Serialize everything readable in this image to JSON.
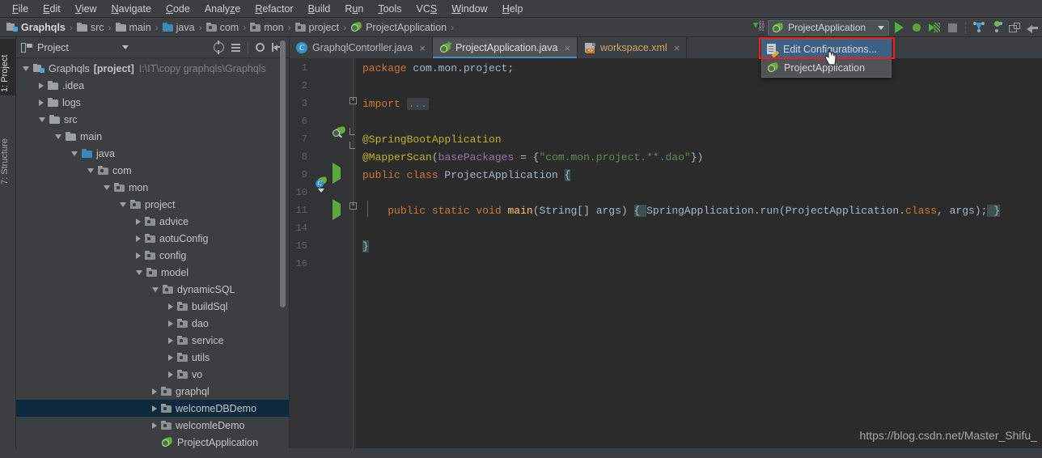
{
  "menubar": {
    "items": [
      {
        "label": "File",
        "mnemonic": "F"
      },
      {
        "label": "Edit",
        "mnemonic": "E"
      },
      {
        "label": "View",
        "mnemonic": "V"
      },
      {
        "label": "Navigate",
        "mnemonic": "N"
      },
      {
        "label": "Code",
        "mnemonic": "C"
      },
      {
        "label": "Analyze",
        "mnemonic": "z"
      },
      {
        "label": "Refactor",
        "mnemonic": "R"
      },
      {
        "label": "Build",
        "mnemonic": "B"
      },
      {
        "label": "Run",
        "mnemonic": "u"
      },
      {
        "label": "Tools",
        "mnemonic": "T"
      },
      {
        "label": "VCS",
        "mnemonic": "S"
      },
      {
        "label": "Window",
        "mnemonic": "W"
      },
      {
        "label": "Help",
        "mnemonic": "H"
      }
    ]
  },
  "breadcrumb": {
    "items": [
      {
        "label": "Graphqls",
        "icon": "module-icon"
      },
      {
        "label": "src",
        "icon": "folder-icon"
      },
      {
        "label": "main",
        "icon": "folder-icon"
      },
      {
        "label": "java",
        "icon": "source-folder-icon"
      },
      {
        "label": "com",
        "icon": "package-icon"
      },
      {
        "label": "mon",
        "icon": "package-icon"
      },
      {
        "label": "project",
        "icon": "package-icon"
      },
      {
        "label": "ProjectApplication",
        "icon": "spring-class-icon"
      }
    ],
    "separator": "›"
  },
  "toolbar": {
    "run_config_name": "ProjectApplication",
    "icons": [
      {
        "name": "step-over-icon",
        "title": "101"
      },
      {
        "name": "run-icon",
        "title": "Run"
      },
      {
        "name": "debug-icon",
        "title": "Debug"
      },
      {
        "name": "run-with-coverage-icon",
        "title": "Run with Coverage"
      },
      {
        "name": "stop-icon",
        "title": "Stop"
      },
      {
        "name": "update-project-icon",
        "title": "Update Project"
      },
      {
        "name": "commit-icon",
        "title": "Commit"
      },
      {
        "name": "settings-window-icon",
        "title": "Settings"
      },
      {
        "name": "back-arrow-icon",
        "title": "Back"
      }
    ]
  },
  "run_config_popup": {
    "items": [
      {
        "label": "Edit Configurations...",
        "icon": "edit-configurations-icon",
        "selected": true
      },
      {
        "label": "ProjectApplication",
        "icon": "spring-class-icon",
        "selected": false
      }
    ],
    "highlight_color": "#ee1c1c",
    "selection_color": "#3d6185"
  },
  "tool_windows": {
    "left": [
      {
        "label": "1: Project",
        "active": true
      },
      {
        "label": "7: Structure",
        "active": false
      }
    ]
  },
  "project_panel": {
    "title": "Project",
    "header_icons": [
      {
        "name": "scroll-from-source-icon"
      },
      {
        "name": "collapse-all-icon"
      },
      {
        "name": "gear-icon"
      },
      {
        "name": "hide-icon"
      }
    ],
    "tree": [
      {
        "depth": 0,
        "label": "Graphqls",
        "bold_suffix": "[project]",
        "path": "I:\\IT\\copy graphqls\\Graphqls",
        "expander": "down",
        "icon": "module-icon",
        "selected": false
      },
      {
        "depth": 1,
        "label": ".idea",
        "expander": "right",
        "icon": "folder-icon",
        "selected": false
      },
      {
        "depth": 1,
        "label": "logs",
        "expander": "right",
        "icon": "folder-icon",
        "selected": false
      },
      {
        "depth": 1,
        "label": "src",
        "expander": "down",
        "icon": "folder-icon",
        "selected": false
      },
      {
        "depth": 2,
        "label": "main",
        "expander": "down",
        "icon": "folder-icon",
        "selected": false
      },
      {
        "depth": 3,
        "label": "java",
        "expander": "down",
        "icon": "source-folder-icon",
        "selected": false
      },
      {
        "depth": 4,
        "label": "com",
        "expander": "down",
        "icon": "package-icon",
        "selected": false
      },
      {
        "depth": 5,
        "label": "mon",
        "expander": "down",
        "icon": "package-icon",
        "selected": false
      },
      {
        "depth": 6,
        "label": "project",
        "expander": "down",
        "icon": "package-icon",
        "selected": false
      },
      {
        "depth": 7,
        "label": "advice",
        "expander": "right",
        "icon": "package-icon",
        "selected": false
      },
      {
        "depth": 7,
        "label": "aotuConfig",
        "expander": "right",
        "icon": "package-icon",
        "selected": false
      },
      {
        "depth": 7,
        "label": "config",
        "expander": "right",
        "icon": "package-icon",
        "selected": false
      },
      {
        "depth": 7,
        "label": "model",
        "expander": "down",
        "icon": "package-icon",
        "selected": false
      },
      {
        "depth": 8,
        "label": "dynamicSQL",
        "expander": "down",
        "icon": "package-icon",
        "selected": false
      },
      {
        "depth": 9,
        "label": "buildSql",
        "expander": "right",
        "icon": "package-icon",
        "selected": false
      },
      {
        "depth": 9,
        "label": "dao",
        "expander": "right",
        "icon": "package-icon",
        "selected": false
      },
      {
        "depth": 9,
        "label": "service",
        "expander": "right",
        "icon": "package-icon",
        "selected": false
      },
      {
        "depth": 9,
        "label": "utils",
        "expander": "right",
        "icon": "package-icon",
        "selected": false
      },
      {
        "depth": 9,
        "label": "vo",
        "expander": "right",
        "icon": "package-icon",
        "selected": false
      },
      {
        "depth": 8,
        "label": "graphql",
        "expander": "right",
        "icon": "package-icon",
        "selected": false
      },
      {
        "depth": 8,
        "label": "welcomeDBDemo",
        "expander": "right",
        "icon": "package-icon",
        "selected": true
      },
      {
        "depth": 8,
        "label": "welcomleDemo",
        "expander": "right",
        "icon": "package-icon",
        "selected": false
      },
      {
        "depth": 8,
        "label": "ProjectApplication",
        "expander": "none",
        "icon": "spring-class-icon",
        "selected": false
      }
    ]
  },
  "editor": {
    "tabs": [
      {
        "label": "GraphqlContorller.java",
        "icon": "java-class-icon",
        "active": false
      },
      {
        "label": "ProjectApplication.java",
        "icon": "spring-class-icon",
        "active": true
      },
      {
        "label": "workspace.xml",
        "icon": "xml-file-icon",
        "active": false
      }
    ],
    "close_glyph": "×",
    "line_numbers": [
      "1",
      "2",
      "3",
      "6",
      "7",
      "8",
      "9",
      "10",
      "11",
      "14",
      "15",
      "16"
    ],
    "code_lines": [
      {
        "line": "1",
        "segments": [
          {
            "t": "package",
            "c": "kw"
          },
          {
            "t": " com.mon.project;",
            "c": "plain"
          }
        ]
      },
      {
        "line": "2",
        "segments": []
      },
      {
        "line": "3",
        "segments": [
          {
            "t": "import",
            "c": "kw"
          },
          {
            "t": " ",
            "c": "plain"
          },
          {
            "t": "...",
            "c": "ellipsis"
          }
        ]
      },
      {
        "line": "6",
        "segments": []
      },
      {
        "line": "7",
        "segments": [
          {
            "t": "@SpringBootApplication",
            "c": "ann"
          }
        ]
      },
      {
        "line": "8",
        "segments": [
          {
            "t": "@MapperScan",
            "c": "ann"
          },
          {
            "t": "(",
            "c": "plain"
          },
          {
            "t": "basePackages",
            "c": "param"
          },
          {
            "t": " = {",
            "c": "plain"
          },
          {
            "t": "\"com.mon.project.**.dao\"",
            "c": "str"
          },
          {
            "t": "})",
            "c": "plain"
          }
        ]
      },
      {
        "line": "9",
        "segments": [
          {
            "t": "public class",
            "c": "kw"
          },
          {
            "t": " ProjectApplication ",
            "c": "plain"
          },
          {
            "t": "{",
            "c": "brace-hl"
          }
        ]
      },
      {
        "line": "10",
        "segments": []
      },
      {
        "line": "11",
        "segments": [
          {
            "t": "    ",
            "c": "plain"
          },
          {
            "t": "public static void",
            "c": "kw"
          },
          {
            "t": " ",
            "c": "plain"
          },
          {
            "t": "main",
            "c": "mth"
          },
          {
            "t": "(String[] args) ",
            "c": "plain"
          },
          {
            "t": "{ ",
            "c": "brace-hl"
          },
          {
            "t": "SpringApplication.run(ProjectApplication.",
            "c": "plain"
          },
          {
            "t": "class",
            "c": "kw"
          },
          {
            "t": ", args);",
            "c": "plain"
          },
          {
            "t": " }",
            "c": "brace-hl"
          }
        ]
      },
      {
        "line": "14",
        "segments": []
      },
      {
        "line": "15",
        "segments": [
          {
            "t": "}",
            "c": "brace-hl"
          }
        ]
      },
      {
        "line": "16",
        "segments": []
      }
    ],
    "gutter_markers": [
      {
        "line": "7",
        "name": "spring-bean-search-icon"
      },
      {
        "line": "9",
        "name": "spring-run-class-icon"
      },
      {
        "line": "9",
        "name": "run-gutter-icon"
      },
      {
        "line": "11",
        "name": "run-gutter-icon"
      }
    ]
  },
  "watermark": {
    "text": "https://blog.csdn.net/Master_Shifu_"
  },
  "colors": {
    "chrome_bg": "#3c3f41",
    "editor_bg": "#2b2b2b",
    "gutter_bg": "#313335",
    "tree_selection": "#0d293e",
    "tab_active": "#4e5254",
    "tab_underline": "#4a88c7",
    "keyword": "#cc7832",
    "annotation": "#bbb529",
    "string": "#6a8759",
    "method": "#ffc66d",
    "parameter": "#9876aa",
    "default_text": "#a9b7c6",
    "accent_red": "#ee1c1c",
    "menu_selection": "#3d6185"
  }
}
